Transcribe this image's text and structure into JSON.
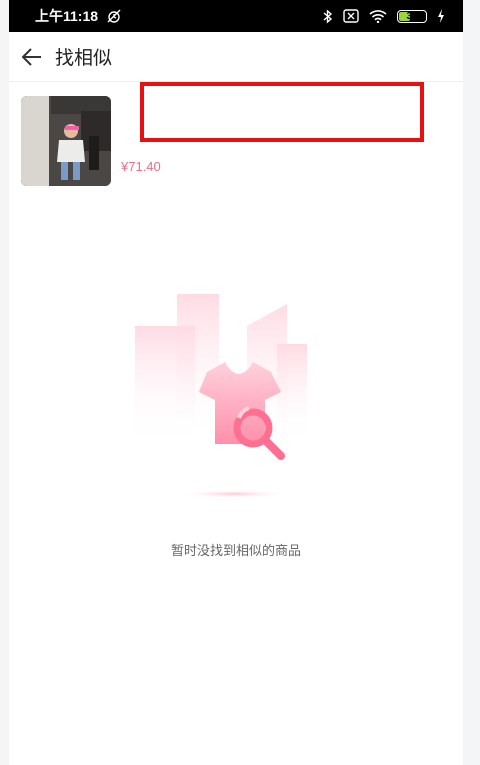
{
  "status": {
    "time": "上午11:18",
    "icons": [
      "alarm-off-icon",
      "bluetooth-icon",
      "sim-icon",
      "wifi-icon",
      "battery-icon",
      "charging-icon"
    ],
    "battery_level": "39",
    "battery_fraction": 0.39
  },
  "nav": {
    "title": "找相似",
    "back_icon": "back-arrow-icon"
  },
  "product": {
    "price": "¥71.40"
  },
  "empty": {
    "message": "暂时没找到相似的商品",
    "icon": "search-shirt-illustration"
  },
  "colors": {
    "price": "#f06b8b",
    "highlight": "#e81010",
    "accent_pink": "#ff7a9a"
  }
}
